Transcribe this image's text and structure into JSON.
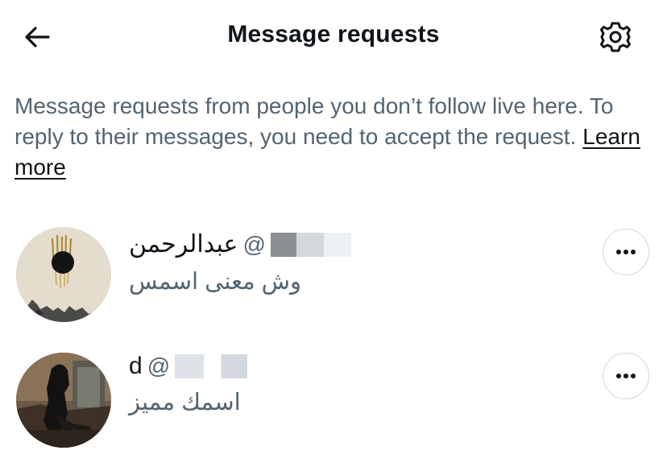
{
  "header": {
    "title": "Message requests",
    "back_icon": "arrow-left-icon",
    "settings_icon": "gear-icon"
  },
  "info": {
    "text": "Message requests from people you don’t follow live here. To reply to their messages, you need to accept the request.",
    "learn_more": "Learn more"
  },
  "requests": [
    {
      "display_name": "عبدالرحمن",
      "handle_prefix": "@",
      "handle_redacted": true,
      "message": "وش معنى اسمس",
      "more_icon": "more-horizontal-icon"
    },
    {
      "display_name": "d",
      "handle_prefix": "@",
      "handle_redacted": true,
      "message": "اسمك مميز",
      "more_icon": "more-horizontal-icon"
    }
  ],
  "colors": {
    "text_primary": "#0f1419",
    "text_secondary": "#536471",
    "border": "#cfd9de"
  }
}
